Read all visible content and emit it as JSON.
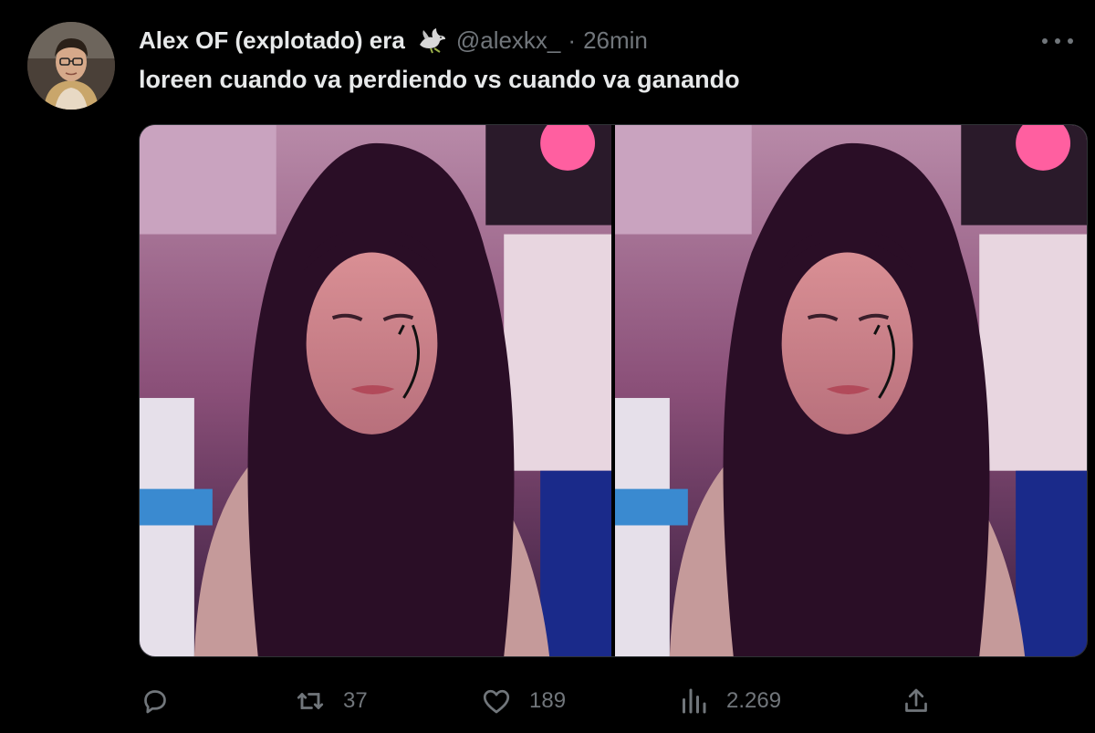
{
  "tweet": {
    "author": {
      "display_name": "Alex OF (explotado) era",
      "handle": "@alexkx_",
      "separator": "·",
      "timestamp": "26min",
      "badge_icon": "dove-icon"
    },
    "text": "loreen cuando va perdiendo vs cuando va ganando",
    "media": {
      "count": 2
    },
    "actions": {
      "reply": {
        "icon": "reply-icon",
        "count": ""
      },
      "retweet": {
        "icon": "retweet-icon",
        "count": "37"
      },
      "like": {
        "icon": "heart-icon",
        "count": "189"
      },
      "views": {
        "icon": "views-icon",
        "count": "2.269"
      },
      "share": {
        "icon": "share-icon"
      }
    }
  },
  "colors": {
    "background": "#000000",
    "primary_text": "#e7e9ea",
    "secondary_text": "#71767b",
    "border": "#2f3336"
  }
}
